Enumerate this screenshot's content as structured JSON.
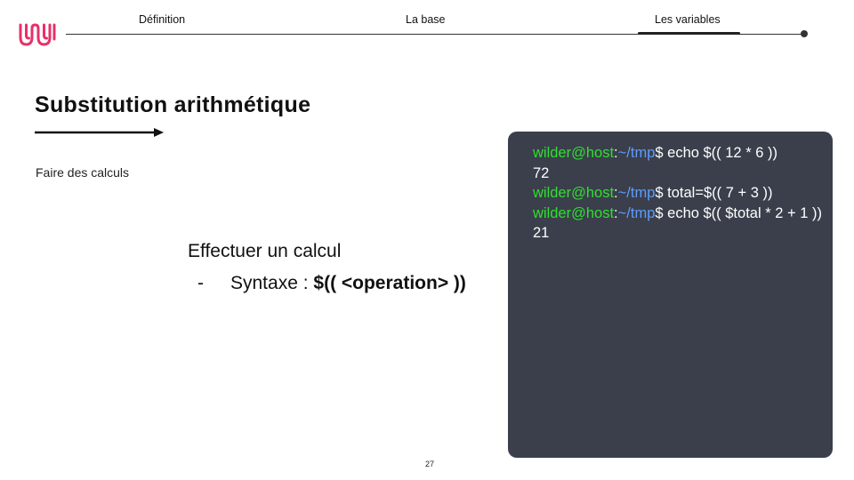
{
  "nav": {
    "items": [
      "Définition",
      "La base",
      "Les variables"
    ],
    "active_index": 2
  },
  "slide": {
    "title": "Substitution arithmétique",
    "subtitle": "Faire des calculs",
    "content_heading": "Effectuer un calcul",
    "bullet": {
      "dash": "-",
      "label": "Syntaxe : ",
      "code": "$(( <operation> ))"
    }
  },
  "terminal": {
    "user": "wilder@host",
    "separator": ":",
    "tilde": "~",
    "path": "/tmp",
    "prompt_char": "$",
    "lines": [
      {
        "command": " echo $(( 12 * 6 ))"
      },
      {
        "output": "72"
      },
      {
        "command": " total=$(( 7 + 3 ))"
      },
      {
        "command": " echo $(( $total * 2 + 1 ))"
      },
      {
        "output": "21"
      }
    ]
  },
  "page_number": "27",
  "colors": {
    "terminal_bg": "#3a3f4b",
    "prompt_user": "#2ee02e",
    "prompt_path": "#5e9cff",
    "logo_accent": "#e8306a"
  },
  "icons": {
    "logo": "wild-code-school-logo-icon",
    "title_arrow": "arrow-right-icon"
  }
}
